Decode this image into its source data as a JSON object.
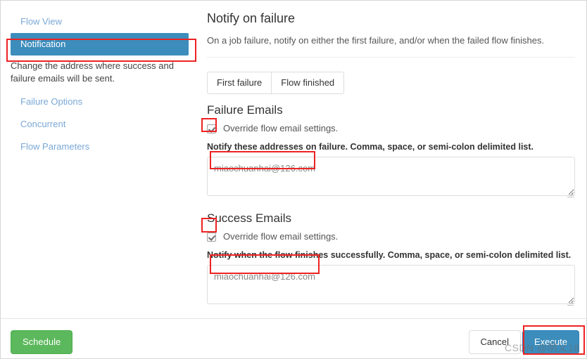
{
  "sidebar": {
    "items": [
      {
        "label": "Flow View",
        "active": false
      },
      {
        "label": "Notification",
        "active": true
      },
      {
        "label": "Failure Options",
        "active": false
      },
      {
        "label": "Concurrent",
        "active": false
      },
      {
        "label": "Flow Parameters",
        "active": false
      }
    ],
    "active_description": "Change the address where success and failure emails will be sent."
  },
  "main": {
    "title": "Notify on failure",
    "subtitle": "On a job failure, notify on either the first failure, and/or when the failed flow finishes.",
    "toggle_group": [
      {
        "label": "First failure",
        "selected": false
      },
      {
        "label": "Flow finished",
        "selected": false
      }
    ],
    "failure": {
      "section_title": "Failure Emails",
      "override_label": "Override flow email settings.",
      "override_checked": true,
      "field_label": "Notify these addresses on failure. Comma, space, or semi-colon delimited list.",
      "value": "miaochuanhai@126.com",
      "placeholder": ""
    },
    "success": {
      "section_title": "Success Emails",
      "override_label": "Override flow email settings.",
      "override_checked": true,
      "field_label": "Notify when the flow finishes successfully. Comma, space, or semi-colon delimited list.",
      "value": "miaochuanhai@126.com",
      "placeholder": ""
    }
  },
  "footer": {
    "schedule_label": "Schedule",
    "cancel_label": "Cancel",
    "execute_label": "Execute"
  },
  "watermark": {
    "text": "CSDN @明乂18"
  },
  "colors": {
    "accent_blue": "#3c8dbc",
    "success_green": "#5cb85c",
    "annotation_red": "#ee2222",
    "link_blue": "#7aa8d6"
  }
}
